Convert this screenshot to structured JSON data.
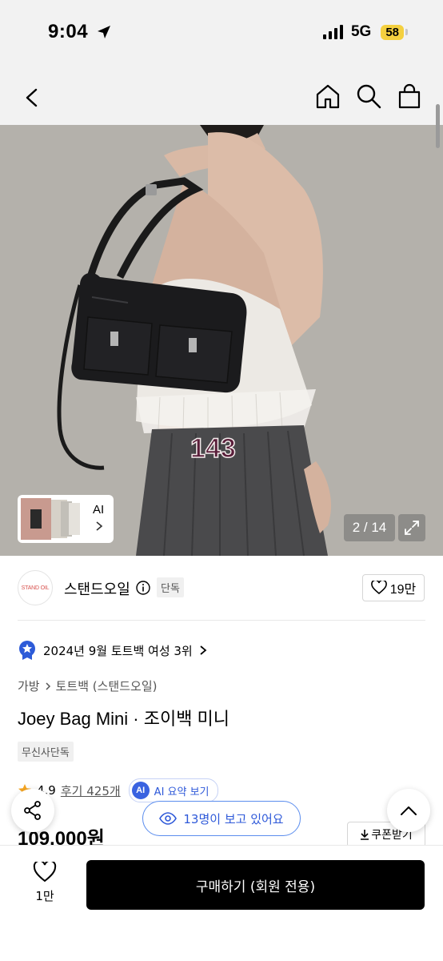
{
  "status_bar": {
    "time": "9:04",
    "network": "5G",
    "battery": "58"
  },
  "nav": {
    "back_icon": "chevron-left",
    "home_icon": "home",
    "search_icon": "search",
    "bag_icon": "shopping-bag"
  },
  "gallery": {
    "thumb_label": "AI",
    "page_counter": "2 / 14",
    "jersey_number": "143"
  },
  "brand": {
    "logo_text": "STAND OIL",
    "name": "스탠드오일",
    "tag": "단독",
    "likes": "19만"
  },
  "ranking": {
    "text": "2024년 9월 토트백 여성 3위"
  },
  "breadcrumb": {
    "category": "가방",
    "subcategory": "토트백 (스탠드오일)"
  },
  "product": {
    "title": "Joey Bag Mini · 조이백 미니",
    "exclusive_tag": "무신사단독",
    "rating": "4.9",
    "reviews": "후기 425개",
    "ai_summary": "AI 요약 보기",
    "ai_badge": "AI",
    "price": "109,000원",
    "coupon": "쿠폰받기"
  },
  "viewers": {
    "text": "13명이 보고 있어요"
  },
  "bottom": {
    "like_count": "1만",
    "buy_label": "구매하기 (회원 전용)"
  },
  "colors": {
    "accent_blue": "#2e59d9",
    "badge_yellow": "#f4d03f",
    "buy_button": "#000000"
  }
}
